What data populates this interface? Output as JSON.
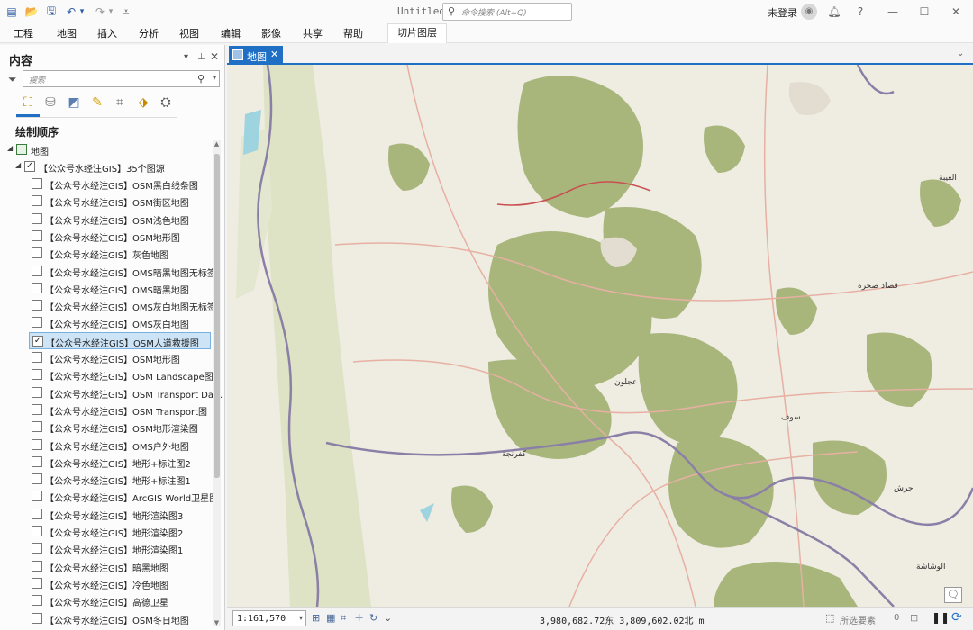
{
  "window": {
    "doc_title": "Untitled",
    "search_placeholder": "命令搜索 (Alt+Q)",
    "login_label": "未登录",
    "help_label": "?",
    "minimize_glyph": "—",
    "maximize_glyph": "☐",
    "close_glyph": "✕"
  },
  "quick_access": {
    "new": "▤",
    "open": "📂",
    "save": "🖫",
    "undo": "↶",
    "redo": "↷",
    "dropdown": "▾",
    "customize": "⩡"
  },
  "menu": [
    "工程",
    "地图",
    "插入",
    "分析",
    "视图",
    "编辑",
    "影像",
    "共享",
    "帮助"
  ],
  "contextual_tab": "切片图层",
  "contents": {
    "title": "内容",
    "search_placeholder": "搜索",
    "drawing_order": "绘制顺序",
    "map_name": "地图",
    "group_name": "【公众号水经注GIS】35个图源",
    "layers": [
      {
        "name": "【公众号水经注GIS】OSM黑白线条图",
        "checked": false
      },
      {
        "name": "【公众号水经注GIS】OSM街区地图",
        "checked": false
      },
      {
        "name": "【公众号水经注GIS】OSM浅色地图",
        "checked": false
      },
      {
        "name": "【公众号水经注GIS】OSM地形图",
        "checked": false
      },
      {
        "name": "【公众号水经注GIS】灰色地图",
        "checked": false
      },
      {
        "name": "【公众号水经注GIS】OMS暗黑地图无标签",
        "checked": false
      },
      {
        "name": "【公众号水经注GIS】OMS暗黑地图",
        "checked": false
      },
      {
        "name": "【公众号水经注GIS】OMS灰白地图无标签",
        "checked": false
      },
      {
        "name": "【公众号水经注GIS】OMS灰白地图",
        "checked": false
      },
      {
        "name": "【公众号水经注GIS】OSM人道救援图",
        "checked": true
      },
      {
        "name": "【公众号水经注GIS】OSM地形图",
        "checked": false
      },
      {
        "name": "【公众号水经注GIS】OSM Landscape图",
        "checked": false
      },
      {
        "name": "【公众号水经注GIS】OSM Transport Da…",
        "checked": false
      },
      {
        "name": "【公众号水经注GIS】OSM Transport图",
        "checked": false
      },
      {
        "name": "【公众号水经注GIS】OSM地形渲染图",
        "checked": false
      },
      {
        "name": "【公众号水经注GIS】OMS户外地图",
        "checked": false
      },
      {
        "name": "【公众号水经注GIS】地形+标注图2",
        "checked": false
      },
      {
        "name": "【公众号水经注GIS】地形+标注图1",
        "checked": false
      },
      {
        "name": "【公众号水经注GIS】ArcGIS World卫星图",
        "checked": false
      },
      {
        "name": "【公众号水经注GIS】地形渲染图3",
        "checked": false
      },
      {
        "name": "【公众号水经注GIS】地形渲染图2",
        "checked": false
      },
      {
        "name": "【公众号水经注GIS】地形渲染图1",
        "checked": false
      },
      {
        "name": "【公众号水经注GIS】暗黑地图",
        "checked": false
      },
      {
        "name": "【公众号水经注GIS】冷色地图",
        "checked": false
      },
      {
        "name": "【公众号水经注GIS】高德卫星",
        "checked": false
      },
      {
        "name": "【公众号水经注GIS】OSM冬日地图",
        "checked": false
      }
    ]
  },
  "map_view": {
    "tab_label": "地图",
    "place_labels": [
      "العيبة",
      "قصاد صحرة",
      "عجلون",
      "سوف",
      "جرش",
      "كفرنجة",
      "الوشاشة"
    ]
  },
  "status_bar": {
    "scale": "1:161,570",
    "coordinates": "3,980,682.72东 3,809,602.02北 m",
    "selected_features_label": "所选要素",
    "selected_features_count": "0"
  }
}
